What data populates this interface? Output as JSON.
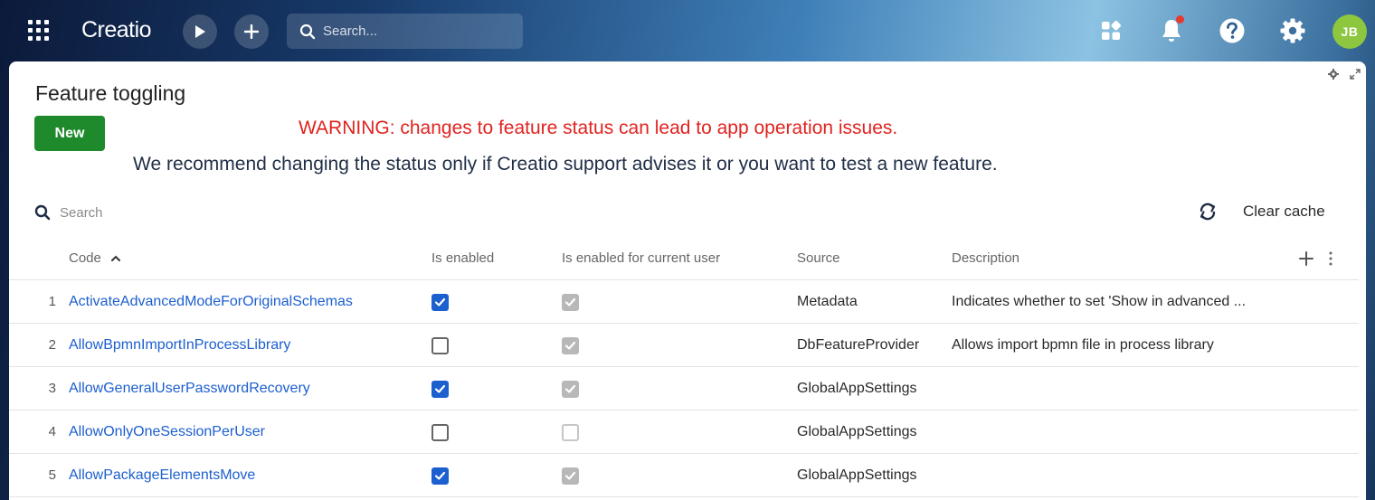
{
  "topbar": {
    "logo": "Creatio",
    "search_placeholder": "Search...",
    "avatar_initials": "JB"
  },
  "page": {
    "title": "Feature toggling",
    "new_label": "New",
    "warning": "WARNING: changes to feature status can lead to app operation issues.",
    "recommendation": "We recommend changing the status only if Creatio support advises it or you want to test a new feature.",
    "search_placeholder": "Search",
    "clear_cache_label": "Clear cache"
  },
  "table": {
    "columns": {
      "code": "Code",
      "is_enabled": "Is enabled",
      "is_enabled_user": "Is enabled for current user",
      "source": "Source",
      "description": "Description"
    },
    "rows": [
      {
        "num": "1",
        "code": "ActivateAdvancedModeForOriginalSchemas",
        "is_enabled": true,
        "is_enabled_user": true,
        "source": "Metadata",
        "description": "Indicates whether to set 'Show in advanced ..."
      },
      {
        "num": "2",
        "code": "AllowBpmnImportInProcessLibrary",
        "is_enabled": false,
        "is_enabled_user": true,
        "source": "DbFeatureProvider",
        "description": "Allows import bpmn file in process library"
      },
      {
        "num": "3",
        "code": "AllowGeneralUserPasswordRecovery",
        "is_enabled": true,
        "is_enabled_user": true,
        "source": "GlobalAppSettings",
        "description": ""
      },
      {
        "num": "4",
        "code": "AllowOnlyOneSessionPerUser",
        "is_enabled": false,
        "is_enabled_user": false,
        "source": "GlobalAppSettings",
        "description": ""
      },
      {
        "num": "5",
        "code": "AllowPackageElementsMove",
        "is_enabled": true,
        "is_enabled_user": true,
        "source": "GlobalAppSettings",
        "description": ""
      }
    ]
  },
  "colors": {
    "link": "#1c5fcf",
    "warning": "#e0231f",
    "primary_button": "#1f8a2c",
    "avatar": "#8dc63f",
    "notification_dot": "#e8392d"
  },
  "icons": [
    "apps-grid-icon",
    "play-icon",
    "plus-icon",
    "search-icon",
    "widgets-icon",
    "bell-icon",
    "help-icon",
    "gear-icon",
    "settings-small-icon",
    "expand-icon",
    "sort-asc-icon",
    "refresh-icon",
    "add-column-icon",
    "more-vertical-icon",
    "checkmark-icon"
  ]
}
